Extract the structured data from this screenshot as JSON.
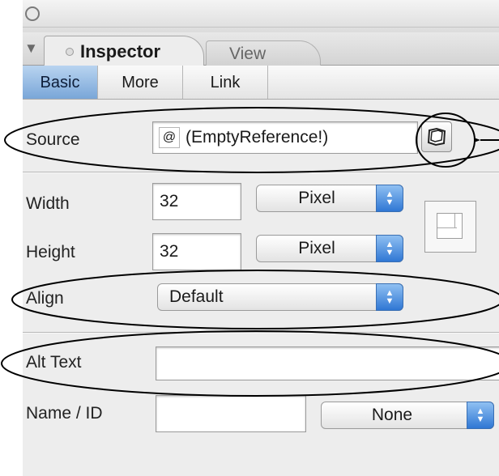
{
  "window": {
    "tabs": [
      {
        "label": "Inspector",
        "active": true
      },
      {
        "label": "View",
        "active": false
      }
    ]
  },
  "subtabs": [
    {
      "label": "Basic",
      "active": true
    },
    {
      "label": "More",
      "active": false
    },
    {
      "label": "Link",
      "active": false
    }
  ],
  "source": {
    "label": "Source",
    "ref_icon": "@",
    "value": "(EmptyReference!)",
    "browse_icon": "file-browse-icon"
  },
  "width": {
    "label": "Width",
    "value": "32",
    "unit": "Pixel"
  },
  "height": {
    "label": "Height",
    "value": "32",
    "unit": "Pixel"
  },
  "align": {
    "label": "Align",
    "value": "Default"
  },
  "alt_text": {
    "label": "Alt Text",
    "value": ""
  },
  "name_id": {
    "label": "Name / ID",
    "value": "",
    "option": "None"
  },
  "colors": {
    "active_tab": "#79a6d8",
    "stepper": "#2f77d4",
    "panel_bg": "#ededed"
  }
}
